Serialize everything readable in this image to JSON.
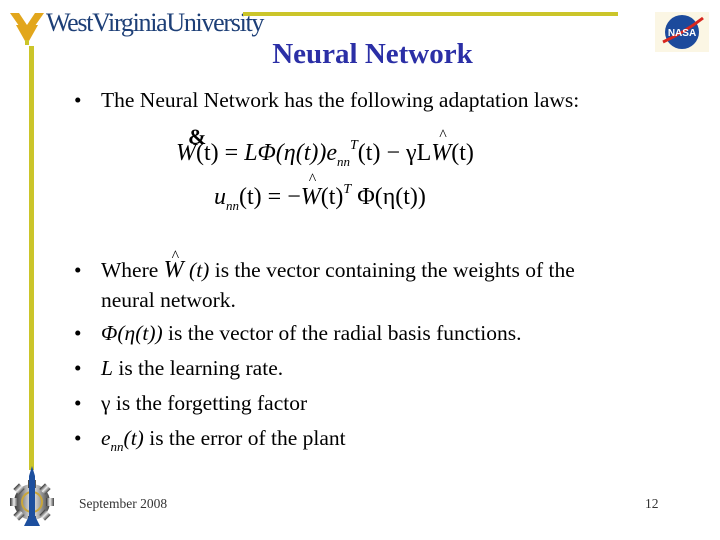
{
  "header": {
    "university_name": "WestVirginiaUniversity",
    "partner_logo_text": "NASA",
    "colors": {
      "rule": "#cbc52a",
      "wvu_gold": "#e2a61c",
      "wvu_blue": "#1d3f77",
      "title": "#2b2fa6"
    }
  },
  "slide": {
    "title": "Neural Network",
    "intro_bullet": "The Neural Network has the following adaptation laws:",
    "equations": {
      "eq1": {
        "lhs": "W",
        "lhs_fn": "(t) = ",
        "rhs": "LΦ(η(t))e",
        "rhs_sub": "nn",
        "rhs_sup": "T",
        "rhs_tail": "(t) − γL",
        "hatW": "W",
        "tail": "(t)",
        "dot_glyph": "&"
      },
      "eq2": {
        "lhs": "u",
        "lhs_sub": "nn",
        "lhs_fn": "(t) = −",
        "hatW": "W",
        "mid": "(t)",
        "sup": "T",
        "tail": " Φ(η(t))"
      }
    },
    "bullets": [
      {
        "prefix": "Where ",
        "math": "W(t)",
        "text": " is the vector containing the weights of the",
        "continuation": "neural network."
      },
      {
        "math": "Φ(η(t))",
        "text": " is the vector of the radial basis functions."
      },
      {
        "math": "L",
        "text": " is the learning rate."
      },
      {
        "math": "γ",
        "text": " is the forgetting factor"
      },
      {
        "math": "e",
        "math_sub": "nn",
        "math_tail": "(t)",
        "text": " is the error of the plant"
      }
    ],
    "bullet_glyph": "•"
  },
  "footer": {
    "date": "September 2008",
    "page_number": "12"
  }
}
